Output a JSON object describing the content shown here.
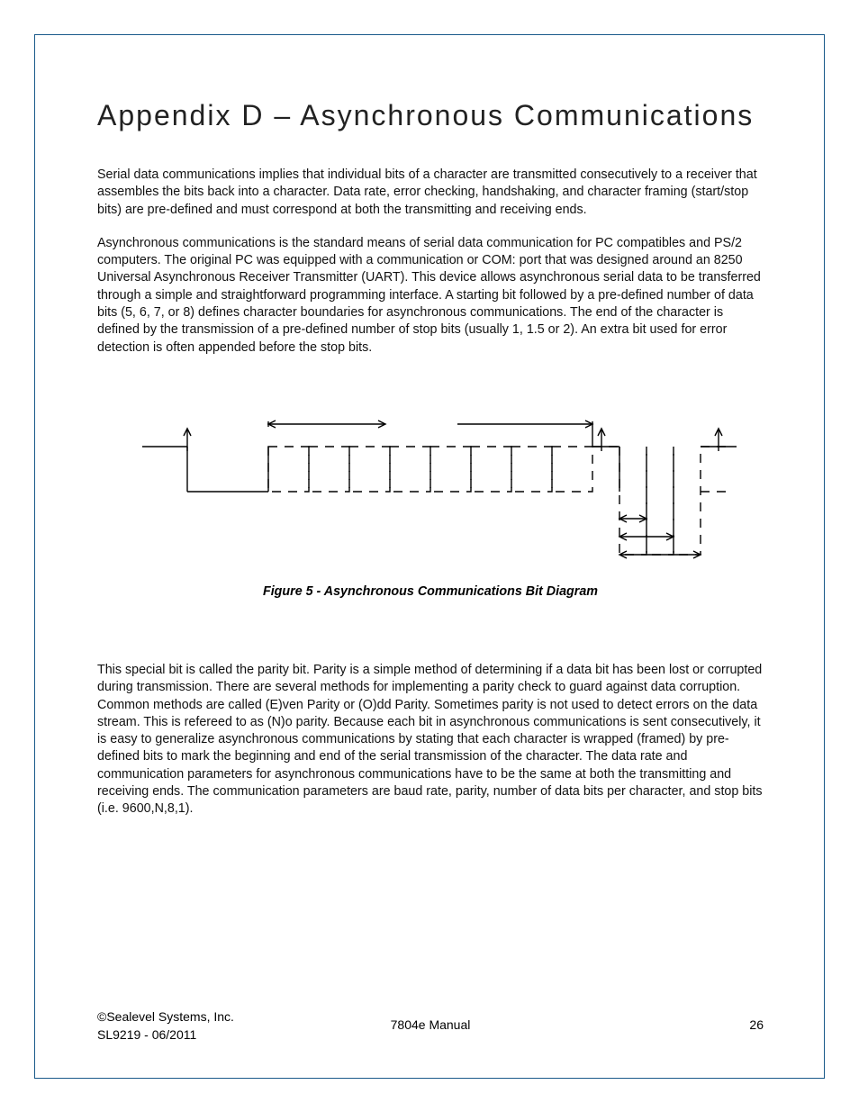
{
  "title": "Appendix D – Asynchronous Communications",
  "para1": "Serial data communications implies that individual bits of a character are transmitted consecutively to a receiver that assembles the bits back into a character. Data rate, error checking, handshaking, and character framing (start/stop bits) are pre-defined and must correspond at both the transmitting and receiving ends.",
  "para2": "Asynchronous communications is the standard means of serial data communication for PC compatibles and PS/2 computers. The original PC was equipped with a communication or COM: port that was designed around an 8250 Universal Asynchronous Receiver Transmitter (UART). This device allows asynchronous serial data to be transferred through a simple and straightforward programming interface. A starting bit followed by a pre-defined number of data bits (5, 6, 7, or 8) defines character boundaries for asynchronous communications. The end of the character is defined by the transmission of a pre-defined number of stop bits (usually 1, 1.5 or 2). An extra bit used for error detection is often appended before the stop bits.",
  "figcaption": "Figure 5 - Asynchronous Communications Bit Diagram",
  "para3": "This special bit is called the parity bit. Parity is a simple method of determining if a data bit has been lost or corrupted during transmission. There are several methods for implementing a parity check to guard against data corruption. Common methods are called (E)ven Parity or (O)dd Parity. Sometimes parity is not used to detect errors on the data stream. This is refereed to as (N)o parity. Because each bit in asynchronous communications is sent consecutively, it is easy to generalize asynchronous communications by stating that each character is wrapped (framed) by pre-defined bits to mark the beginning and end of the serial transmission of the character. The data rate and communication parameters for asynchronous communications have to be the same at both the transmitting and receiving ends. The communication parameters are baud rate, parity, number of data bits per character, and stop bits (i.e. 9600,N,8,1).",
  "footer": {
    "copyright": "©Sealevel Systems, Inc.",
    "docref": "SL9219 - 06/2011",
    "manual": "7804e Manual",
    "page": "26"
  }
}
